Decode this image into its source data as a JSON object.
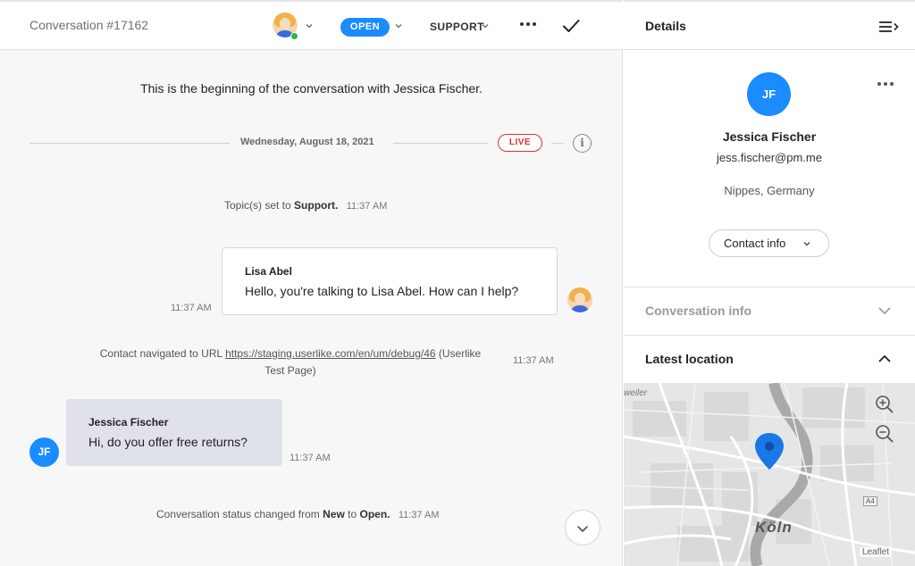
{
  "conversation": {
    "title": "Conversation #17162",
    "status_label": "OPEN",
    "topic_label": "SUPPORT",
    "intro_prefix": "This is the beginning of the conversation with ",
    "intro_name": "Jessica Fischer.",
    "date": "Wednesday, August 18, 2021",
    "live_label": "LIVE",
    "info_icon_glyph": "i",
    "colors": {
      "accent": "#1a8cff",
      "live": "#e03131",
      "online": "#2bb24c"
    }
  },
  "messages": {
    "topic_set": {
      "prefix": "Topic(s) set to ",
      "value": "Support.",
      "time": "11:37 AM"
    },
    "agent": {
      "name": "Lisa Abel",
      "text": "Hello, you're talking to Lisa Abel. How can I help?",
      "time": "11:37 AM"
    },
    "navigated": {
      "prefix": "Contact navigated to URL ",
      "url": "https://staging.userlike.com/en/um/debug/46",
      "suffix": " (Userlike",
      "line2": "Test Page)",
      "time": "11:37 AM"
    },
    "contact": {
      "name": "Jessica Fischer",
      "text": "Hi, do you offer free returns?",
      "time": "11:37 AM",
      "initials": "JF"
    },
    "status_change": {
      "prefix": "Conversation status changed from ",
      "from": "New",
      "middle": " to ",
      "to": "Open.",
      "time": "11:37 AM"
    }
  },
  "details": {
    "title": "Details",
    "contact_initials": "JF",
    "contact_name": "Jessica Fischer",
    "contact_email": "jess.fischer@pm.me",
    "contact_location": "Nippes, Germany",
    "contact_info_button": "Contact info",
    "sections": {
      "conversation_info": "Conversation info",
      "latest_location": "Latest location"
    },
    "map": {
      "city": "Köln",
      "town_fragment": "weiler",
      "road_tag": "A4",
      "attribution": "Leaflet"
    }
  }
}
